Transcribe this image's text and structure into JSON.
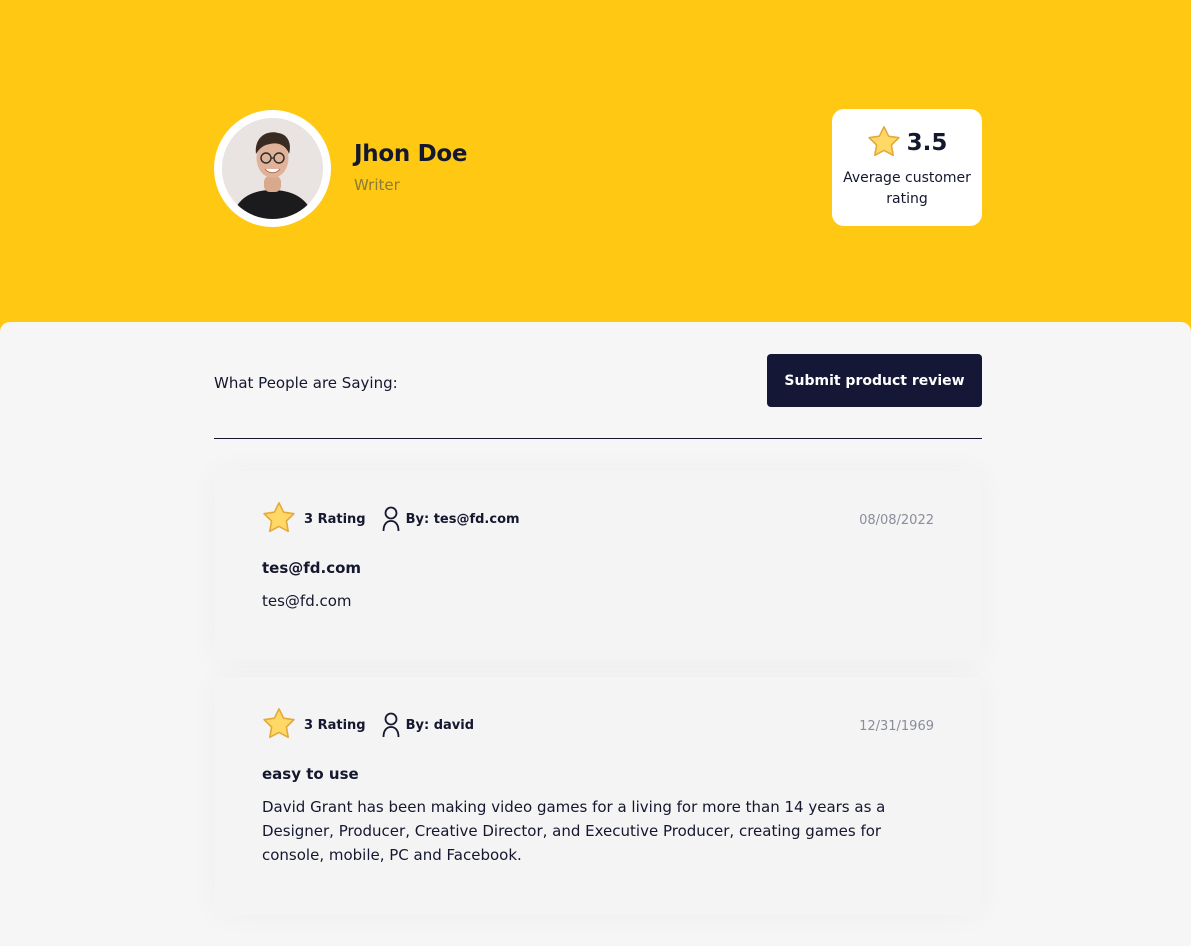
{
  "profile": {
    "name": "Jhon Doe",
    "role": "Writer",
    "avatar_icon": "person-photo"
  },
  "rating_summary": {
    "value": "3.5",
    "caption": "Average customer rating",
    "icon": "star-icon"
  },
  "reviews_section": {
    "title": "What People are Saying:",
    "submit_label": "Submit product review"
  },
  "reviews": [
    {
      "rating_label": "3 Rating",
      "author_label": "By: tes@fd.com",
      "date": "08/08/2022",
      "title": "tes@fd.com",
      "body": "tes@fd.com"
    },
    {
      "rating_label": "3 Rating",
      "author_label": "By: david",
      "date": "12/31/1969",
      "title": "easy to use",
      "body": "David Grant has been making video games for a living for more than 14 years as a Designer, Producer, Creative Director, and Executive Producer, creating games for console, mobile, PC and Facebook."
    }
  ],
  "colors": {
    "hero_background": "#ffc913",
    "page_background": "#f6f6f6",
    "dark_navy": "#14172e",
    "button_background": "#141735",
    "star_fill": "#ffd866",
    "star_stroke": "#e3a93a"
  }
}
